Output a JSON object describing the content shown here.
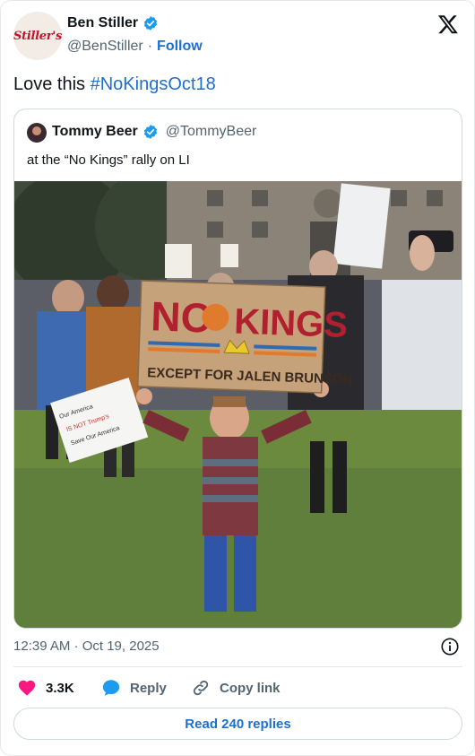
{
  "author": {
    "name": "Ben Stiller",
    "handle": "@BenStiller",
    "separator": "·",
    "follow_label": "Follow",
    "avatar_text": "Stiller's"
  },
  "tweet": {
    "text": "Love this ",
    "hashtag": "#NoKingsOct18",
    "timestamp": "12:39 AM · Oct 19, 2025"
  },
  "quoted": {
    "name": "Tommy Beer",
    "handle": "@TommyBeer",
    "text": "at the “No Kings” rally on LI",
    "photo": {
      "sign_line1": "NO",
      "sign_line2": "KINGS",
      "sign_line3": "EXCEPT FOR JALEN BRUNSON",
      "small_sign": "Our America IS NOT Trump's America. Save Our America"
    }
  },
  "actions": {
    "like_count": "3.3K",
    "reply_label": "Reply",
    "copy_label": "Copy link",
    "read_replies_label": "Read 240 replies"
  },
  "colors": {
    "accent": "#1d6fd0",
    "like": "#f91880",
    "verified": "#1d9bf0",
    "muted": "#536471"
  },
  "icons": [
    "verified-badge-icon",
    "x-logo-icon",
    "info-icon",
    "heart-icon",
    "reply-bubble-icon",
    "link-icon"
  ]
}
